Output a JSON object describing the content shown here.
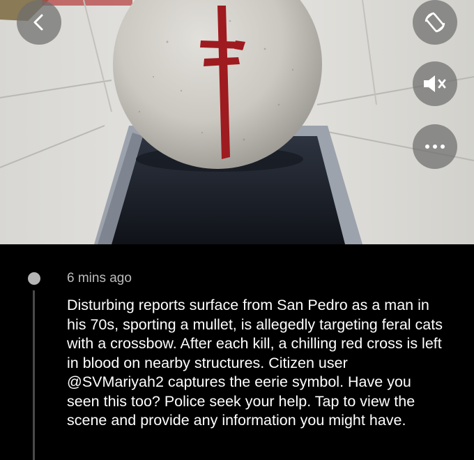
{
  "video": {
    "scene": "concrete-sphere-red-cross"
  },
  "controls": {
    "back_icon": "chevron-left-icon",
    "rotate_icon": "rotate-screen-icon",
    "mute_icon": "speaker-muted-icon",
    "more_icon": "more-dots-icon",
    "more_label": "..."
  },
  "incident": {
    "time_ago": "6 mins ago",
    "description": "Disturbing reports surface from San Pedro as a man in his 70s, sporting a mullet, is allegedly targeting feral cats with a crossbow. After each kill, a chilling red cross is left in blood on nearby structures. Citizen user @SVMariyah2 captures the eerie symbol. Have you seen this too? Police seek your help. Tap to view the scene and provide any information you might have."
  },
  "colors": {
    "background": "#000000",
    "text_primary": "#ffffff",
    "text_secondary": "#bcbcbc",
    "cross_red": "#9e1b1f",
    "overlay_button": "#6e6e6e"
  }
}
